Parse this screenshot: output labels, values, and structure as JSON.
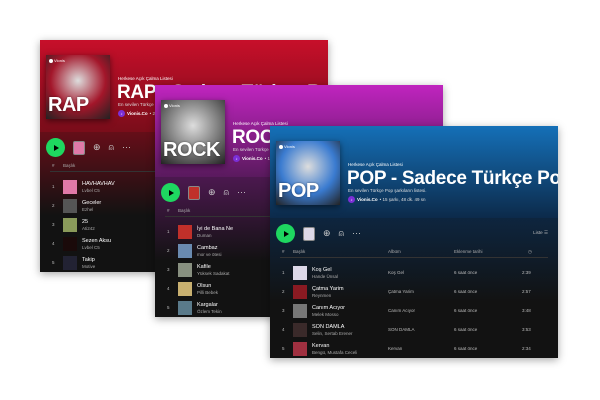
{
  "windows": [
    {
      "id": "rap",
      "cover_word": "RAP",
      "brand": "Vionis",
      "label": "Herkese Açık Çalma Listesi",
      "title": "RAP - Sadece Türkçe Rap",
      "description": "En sevilen Türkçe Rap şarkılarının listesi.",
      "owner": "Vionis.Co",
      "meta": "• 20 şarkı",
      "col_num": "#",
      "col_title": "Başlık",
      "colors": {
        "top": "#c70f2a",
        "bottom": "#7a0d1a",
        "cover": "#a3162a"
      },
      "tracks": [
        {
          "n": "1",
          "title": "HAVHAVHAV",
          "artist": "Lvbel C5",
          "color": "#e07aa8"
        },
        {
          "n": "2",
          "title": "Geceler",
          "artist": "Ezhel",
          "color": "#555"
        },
        {
          "n": "3",
          "title": "25",
          "artist": "Ati242",
          "color": "#8a9a5a"
        },
        {
          "n": "4",
          "title": "Sezen Aksu",
          "artist": "Lvbel C5",
          "color": "#1a0a0a"
        },
        {
          "n": "5",
          "title": "Takip",
          "artist": "Motive",
          "color": "#223"
        }
      ]
    },
    {
      "id": "rock",
      "cover_word": "ROCK",
      "brand": "Vionis",
      "label": "Herkese Açık Çalma Listesi",
      "title": "ROCK - Sadece Türkçe Rock",
      "description": "En sevilen Türkçe Rock şarkılarının listesi.",
      "owner": "Vionis.Co",
      "meta": "• 15 şarkı",
      "col_num": "#",
      "col_title": "Başlık",
      "colors": {
        "top": "#c024bf",
        "bottom": "#5a1a5e",
        "cover": "#777"
      },
      "tracks": [
        {
          "n": "1",
          "title": "İyi de Bana Ne",
          "artist": "Duman",
          "color": "#c0302a"
        },
        {
          "n": "2",
          "title": "Cambaz",
          "artist": "mor ve ötesi",
          "color": "#6a8ab0"
        },
        {
          "n": "3",
          "title": "Kafile",
          "artist": "Yüksek Sadakat",
          "color": "#889080"
        },
        {
          "n": "4",
          "title": "Olsun",
          "artist": "Pilli Bebek",
          "color": "#c8b070"
        },
        {
          "n": "5",
          "title": "Kargalar",
          "artist": "Özlem Tekin",
          "color": "#5a7a8a"
        }
      ]
    },
    {
      "id": "pop",
      "cover_word": "POP",
      "brand": "Vionis",
      "label": "Herkese Açık Çalma Listesi",
      "title": "POP - Sadece Türkçe Pop",
      "description": "En sevilen Türkçe Pop şarkıların listesi.",
      "owner": "Vionis.Co",
      "meta": "• 15 şarkı, 48 dk. 49 sn",
      "col_num": "#",
      "col_title": "Başlık",
      "col_album": "Albüm",
      "col_date": "Eklenme tarihi",
      "view_mode": "Liste",
      "colors": {
        "top": "#1570b8",
        "bottom": "#0c2a4a",
        "cover": "#3a7bd0"
      },
      "tracks": [
        {
          "n": "1",
          "title": "Koş Gel",
          "artist": "Hande Ünsal",
          "album": "Koş Gel",
          "date": "6 saat önce",
          "dur": "2:39",
          "color": "#dcd8e8"
        },
        {
          "n": "2",
          "title": "Çatma Yarim",
          "artist": "Reynmen",
          "album": "Çatma Yarim",
          "date": "6 saat önce",
          "dur": "2:57",
          "color": "#8a1a22"
        },
        {
          "n": "3",
          "title": "Canım Acıyor",
          "artist": "Melek Mosso",
          "album": "Canım Acıyor",
          "date": "6 saat önce",
          "dur": "3:48",
          "color": "#777"
        },
        {
          "n": "4",
          "title": "SON DAMLA",
          "artist": "Selin, Sertab Erener",
          "album": "SON DAMLA",
          "date": "6 saat önce",
          "dur": "3:53",
          "color": "#3a2a2a"
        },
        {
          "n": "5",
          "title": "Kervan",
          "artist": "Bengü, Mustafa Ceceli",
          "album": "Kervan",
          "date": "6 saat önce",
          "dur": "2:34",
          "color": "#a03040"
        }
      ]
    }
  ]
}
